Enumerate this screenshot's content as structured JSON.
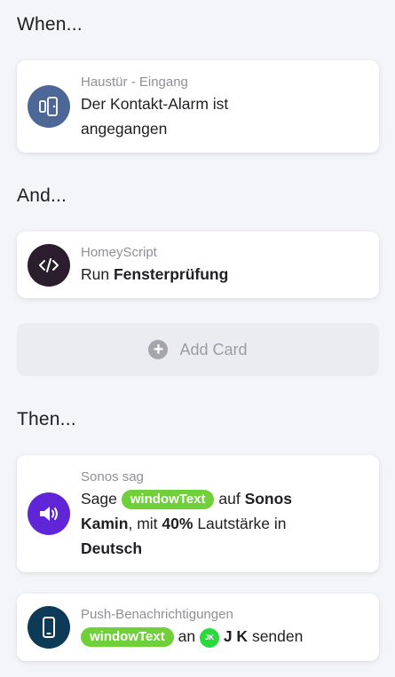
{
  "sections": {
    "when": "When...",
    "and": "And...",
    "then": "Then..."
  },
  "when_card": {
    "icon": "door-contact-sensor-icon",
    "icon_color": "#4d6896",
    "subtitle": "Haustür - Eingang",
    "text_line1": "Der Kontakt-Alarm ist",
    "text_line2": "angegangen"
  },
  "and_card": {
    "icon": "code-icon",
    "icon_color": "#2b1d2d",
    "subtitle": "HomeyScript",
    "text_prefix": "Run",
    "text_bold": "Fensterprüfung"
  },
  "add_card": {
    "icon": "plus-circle-icon",
    "label": "Add Card"
  },
  "sonos_card": {
    "icon": "speaker-volume-icon",
    "icon_color": "#6025d6",
    "subtitle": "Sonos sag",
    "word_sage": "Sage",
    "tag": "windowText",
    "word_auf": "auf",
    "device_part1": "Sonos",
    "device_part2": "Kamin",
    "word_mit": ", mit",
    "volume": "40%",
    "word_volume": "Lautstärke in",
    "language": "Deutsch"
  },
  "push_card": {
    "icon": "smartphone-icon",
    "icon_color": "#0c3a57",
    "subtitle": "Push-Benachrichtigungen",
    "tag": "windowText",
    "word_an": "an",
    "avatar_initials": "JK",
    "user_name": "J K",
    "word_senden": "senden",
    "avatar_color": "#2bd93c"
  }
}
